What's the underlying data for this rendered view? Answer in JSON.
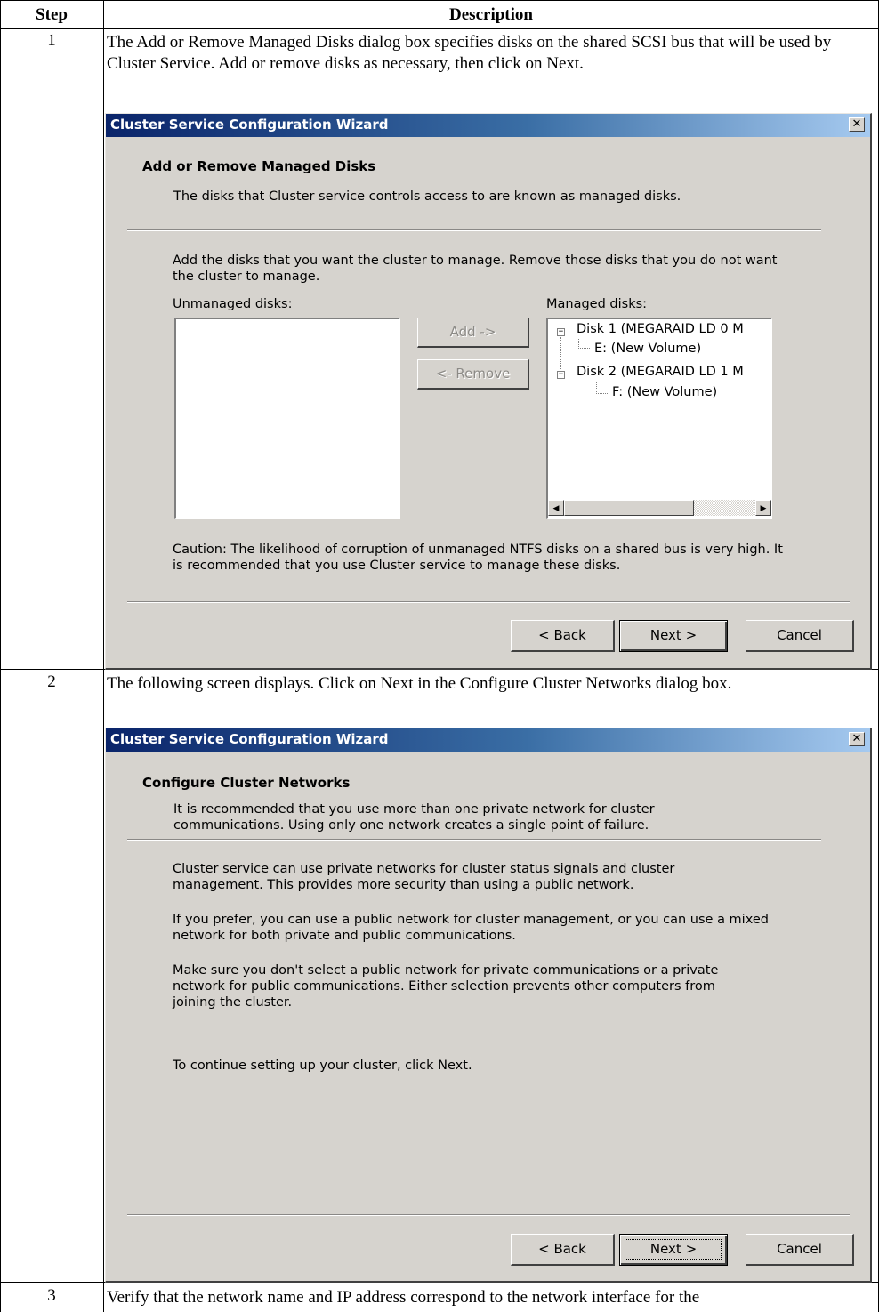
{
  "table": {
    "header_step": "Step",
    "header_description": "Description"
  },
  "steps": [
    {
      "number": "1",
      "text": "The Add or Remove Managed Disks dialog box specifies disks on the shared SCSI bus that will be used by Cluster Service. Add or remove disks as necessary, then click on Next.",
      "dialog": {
        "title": "Cluster Service Configuration Wizard",
        "close_glyph": "✕",
        "page_title": "Add or Remove Managed Disks",
        "page_subtitle": "The disks that Cluster service controls access to are known as managed disks.",
        "instructions": "Add the disks that you want the cluster to manage. Remove those disks that you do not want the cluster to manage.",
        "unmanaged_label": "Unmanaged disks:",
        "managed_label": "Managed disks:",
        "add_button": "Add ->",
        "remove_button": "<- Remove",
        "tree": [
          {
            "label": "Disk 1 (MEGARAID LD  0 M",
            "expander": "−"
          },
          {
            "label": "E: (New Volume)"
          },
          {
            "label": "Disk 2 (MEGARAID LD  1 M",
            "expander": "−"
          },
          {
            "label": "F: (New Volume)"
          }
        ],
        "scroll_left": "◀",
        "scroll_right": "▶",
        "caution": "Caution: The likelihood of corruption of unmanaged NTFS disks on a shared bus is very high. It is recommended that you use Cluster service to manage these disks.",
        "back_button": "< Back",
        "next_button": "Next >",
        "cancel_button": "Cancel"
      }
    },
    {
      "number": "2",
      "text": "The following screen displays. Click on Next in the Configure Cluster Networks dialog box.",
      "dialog": {
        "title": "Cluster Service Configuration Wizard",
        "close_glyph": "✕",
        "page_title": "Configure Cluster Networks",
        "page_subtitle": "It is recommended that you use more than one private network for cluster communications. Using only one network creates a single point of failure.",
        "paragraphs": [
          "Cluster service can use private networks for cluster status signals and cluster management. This provides more security than using a public network.",
          "If you prefer, you can use a  public network for cluster management, or you can use a mixed network for both private and public communications.",
          "Make sure you don't select a public network for private communications or a private network for public communications. Either selection prevents other computers from joining the cluster.",
          "To continue setting up your cluster, click Next."
        ],
        "back_button": "< Back",
        "next_button": "Next >",
        "cancel_button": "Cancel"
      }
    },
    {
      "number": "3",
      "text": "Verify that the network name and IP address correspond to the network interface for the"
    }
  ]
}
